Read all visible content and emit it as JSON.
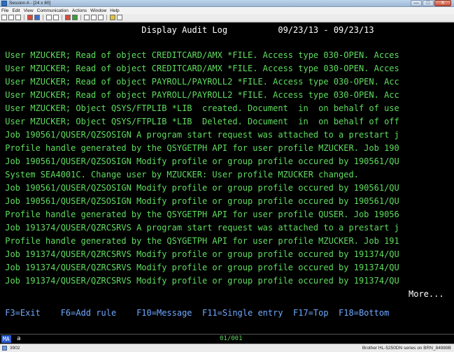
{
  "window": {
    "title": "Session A - [24 x 80]",
    "min": "—",
    "max": "□",
    "close": "X"
  },
  "menu": [
    "File",
    "Edit",
    "View",
    "Communication",
    "Actions",
    "Window",
    "Help"
  ],
  "terminal": {
    "header": "                            Display Audit Log          09/23/13 - 09/23/13",
    "lines": [
      " User MZUCKER; Read of object CREDITCARD/AMX *FILE. Access type 030-OPEN. Acces",
      " User MZUCKER; Read of object CREDITCARD/AMX *FILE. Access type 030-OPEN. Acces",
      " User MZUCKER; Read of object PAYROLL/PAYROLL2 *FILE. Access type 030-OPEN. Acc",
      " User MZUCKER; Read of object PAYROLL/PAYROLL2 *FILE. Access type 030-OPEN. Acc",
      " User MZUCKER; Object QSYS/FTPLIB *LIB  created. Document  in  on behalf of use",
      " User MZUCKER; Object QSYS/FTPLIB *LIB  Deleted. Document  in  on behalf of off",
      " Job 190561/QUSER/QZSOSIGN A program start request was attached to a prestart j",
      " Profile handle generated by the QSYGETPH API for user profile MZUCKER. Job 190",
      " Job 190561/QUSER/QZSOSIGN Modify profile or group profile occured by 190561/QU",
      " System SEA4001C. Change user by MZUCKER: User profile MZUCKER changed.",
      " Job 190561/QUSER/QZSOSIGN Modify profile or group profile occured by 190561/QU",
      " Job 190561/QUSER/QZSOSIGN Modify profile or group profile occured by 190561/QU",
      " Profile handle generated by the QSYGETPH API for user profile QUSER. Job 19056",
      " Job 191374/QUSER/QZRCSRVS A program start request was attached to a prestart j",
      " Profile handle generated by the QSYGETPH API for user profile MZUCKER. Job 191",
      " Job 191374/QUSER/QZRCSRVS Modify profile or group profile occured by 191374/QU",
      " Job 191374/QUSER/QZRCSRVS Modify profile or group profile occured by 191374/QU",
      " Job 191374/QUSER/QZRCSRVS Modify profile or group profile occured by 191374/QU"
    ],
    "more": "More...",
    "fkeys": " F3=Exit    F6=Add rule    F10=Message  F11=Single entry  F17=Top  F18=Bottom"
  },
  "oia": {
    "ma": "MA",
    "a": "a",
    "cursor_pos": "01/001"
  },
  "status": {
    "left": "3902",
    "right": "Brother HL-5250DN series on BRN_84989B"
  },
  "colors": {
    "screen_bg": "#000000",
    "text_green": "#5fdc5f",
    "text_white": "#ffffff",
    "text_blue": "#6fa9ff"
  }
}
